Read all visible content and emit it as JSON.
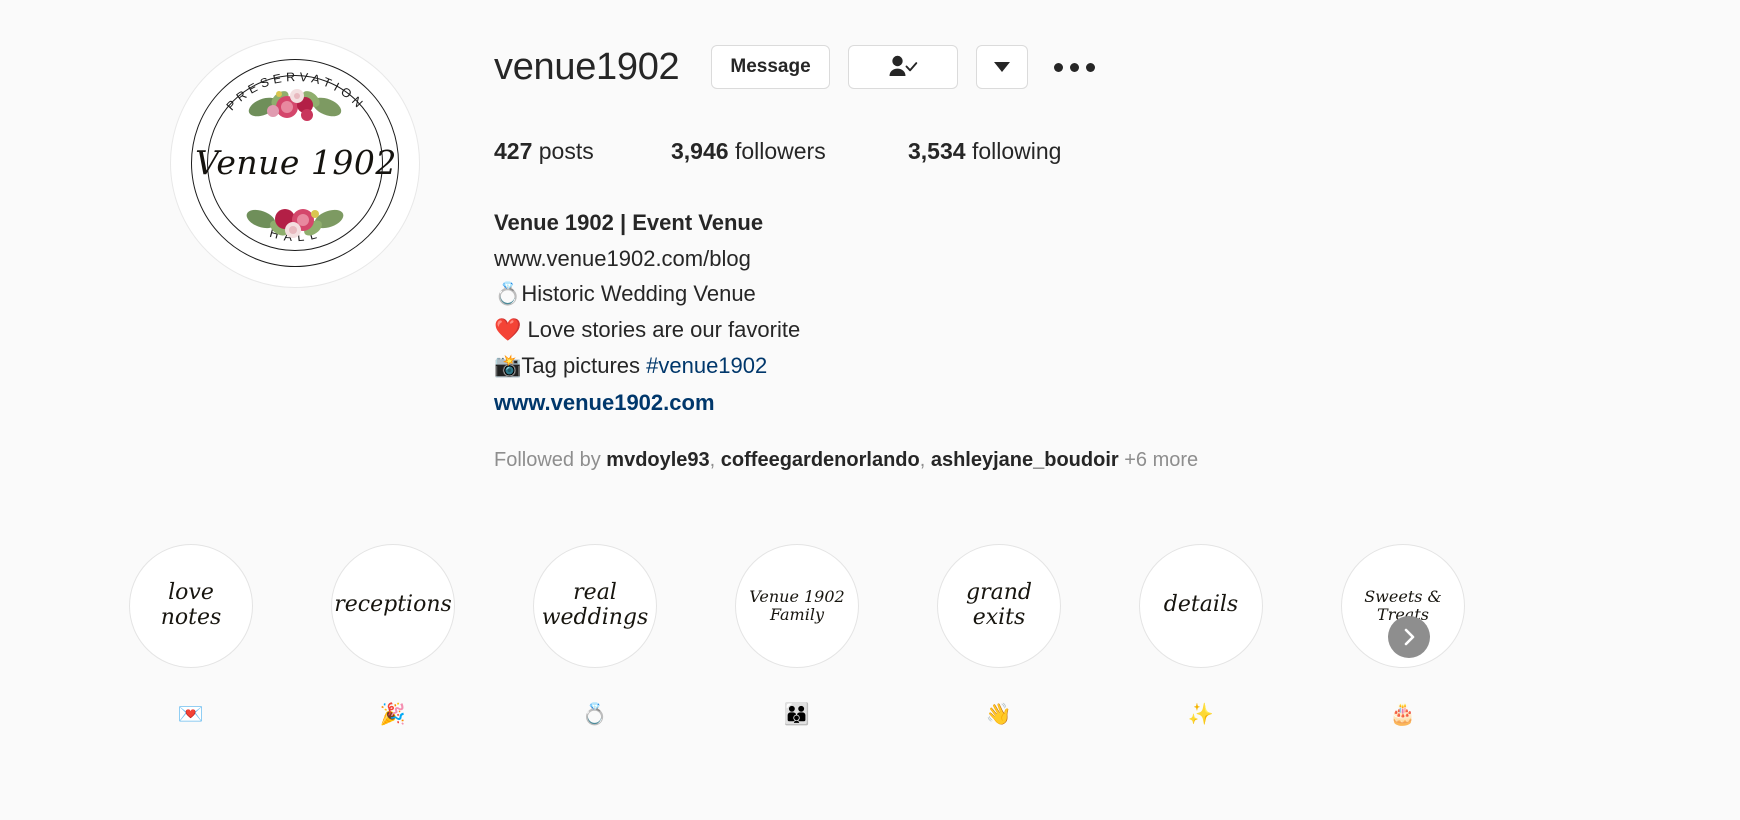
{
  "profile": {
    "username": "venue1902",
    "avatar": {
      "top_arc_text": "PRESERVATION",
      "script_text": "Venue 1902",
      "bottom_arc_text": "HALL"
    },
    "buttons": {
      "message_label": "Message",
      "following_icon": "person-check-icon",
      "dropdown_icon": "chevron-down-icon",
      "options_icon": "more-options-icon"
    },
    "stats": [
      {
        "value": "427",
        "label": "posts"
      },
      {
        "value": "3,946",
        "label": "followers"
      },
      {
        "value": "3,534",
        "label": "following"
      }
    ],
    "bio": {
      "title": "Venue 1902 | Event Venue",
      "lines": [
        {
          "text": "www.venue1902.com/blog"
        },
        {
          "text": "💍Historic Wedding Venue"
        },
        {
          "text": "❤️ Love stories are our favorite"
        },
        {
          "text": "📸Tag pictures ",
          "link": "#venue1902"
        }
      ],
      "website": "www.venue1902.com"
    },
    "followed_by": {
      "prefix": "Followed by",
      "names": [
        "mvdoyle93",
        "coffeegardenorlando",
        "ashleyjane_boudoir"
      ],
      "more": "+6 more"
    }
  },
  "highlights": [
    {
      "title": "love\nnotes",
      "label": "💌",
      "size": "lg"
    },
    {
      "title": "receptions",
      "label": "🎉",
      "size": "lg"
    },
    {
      "title": "real\nweddings",
      "label": "💍",
      "size": "lg"
    },
    {
      "title": "Venue 1902\nFamily",
      "label": "👪",
      "size": "sm"
    },
    {
      "title": "grand\nexits",
      "label": "👋",
      "size": "lg"
    },
    {
      "title": "details",
      "label": "✨",
      "size": "lg"
    },
    {
      "title": "Sweets &\nTreats",
      "label": "🎂",
      "size": "sm"
    }
  ],
  "next_button_icon": "chevron-right-icon",
  "colors": {
    "background": "#fafafa",
    "text": "#262626",
    "link": "#00376b",
    "muted": "#8e8e8e",
    "border": "#dbdbdb"
  }
}
